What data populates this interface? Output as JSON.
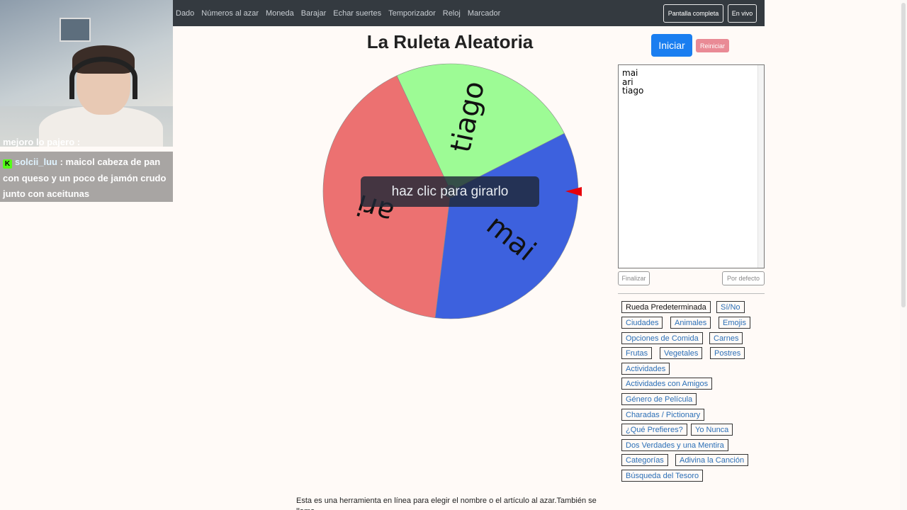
{
  "nav": {
    "links": [
      "Dado",
      "Números al azar",
      "Moneda",
      "Barajar",
      "Echar suertes",
      "Temporizador",
      "Reloj",
      "Marcador"
    ],
    "fullscreen": "Pantalla completa",
    "live": "En vivo"
  },
  "stream": {
    "partial_line": "mejoro lo pajero :",
    "chat": {
      "badge": "K",
      "username": "solcii_luu",
      "message": ": maicol cabeza de pan con queso y un poco de jamón crudo junto con aceitunas"
    }
  },
  "page": {
    "title": "La Ruleta Aleatoria",
    "start": "Iniciar",
    "reset": "Reiniciar",
    "overlay": "haz clic para girarlo"
  },
  "wheel": {
    "segments": [
      {
        "label": "tiago",
        "color": "#9dfb95"
      },
      {
        "label": "mai",
        "color": "#3d61de"
      },
      {
        "label": "ari",
        "color": "#ec7171"
      }
    ],
    "pointer_color": "#e8000a"
  },
  "names": {
    "lines": [
      "mai",
      "ari",
      "tiago"
    ],
    "finalize": "Finalizar",
    "default": "Por defecto"
  },
  "presets": [
    "Rueda Predeterminada",
    "Sí/No",
    "Ciudades",
    "Animales",
    "Emojis",
    "Opciones de Comida",
    "Carnes",
    "Frutas",
    "Vegetales",
    "Postres",
    "Actividades",
    "Actividades con Amigos",
    "Género de Película",
    "Charadas / Pictionary",
    "¿Qué Prefieres?",
    "Yo Nunca",
    "Dos Verdades y una Mentira",
    "Categorías",
    "Adivina la Canción",
    "Búsqueda del Tesoro"
  ],
  "footer": {
    "text": "Esta es una herramienta en línea para elegir el nombre o el artículo al azar.También se llama"
  }
}
